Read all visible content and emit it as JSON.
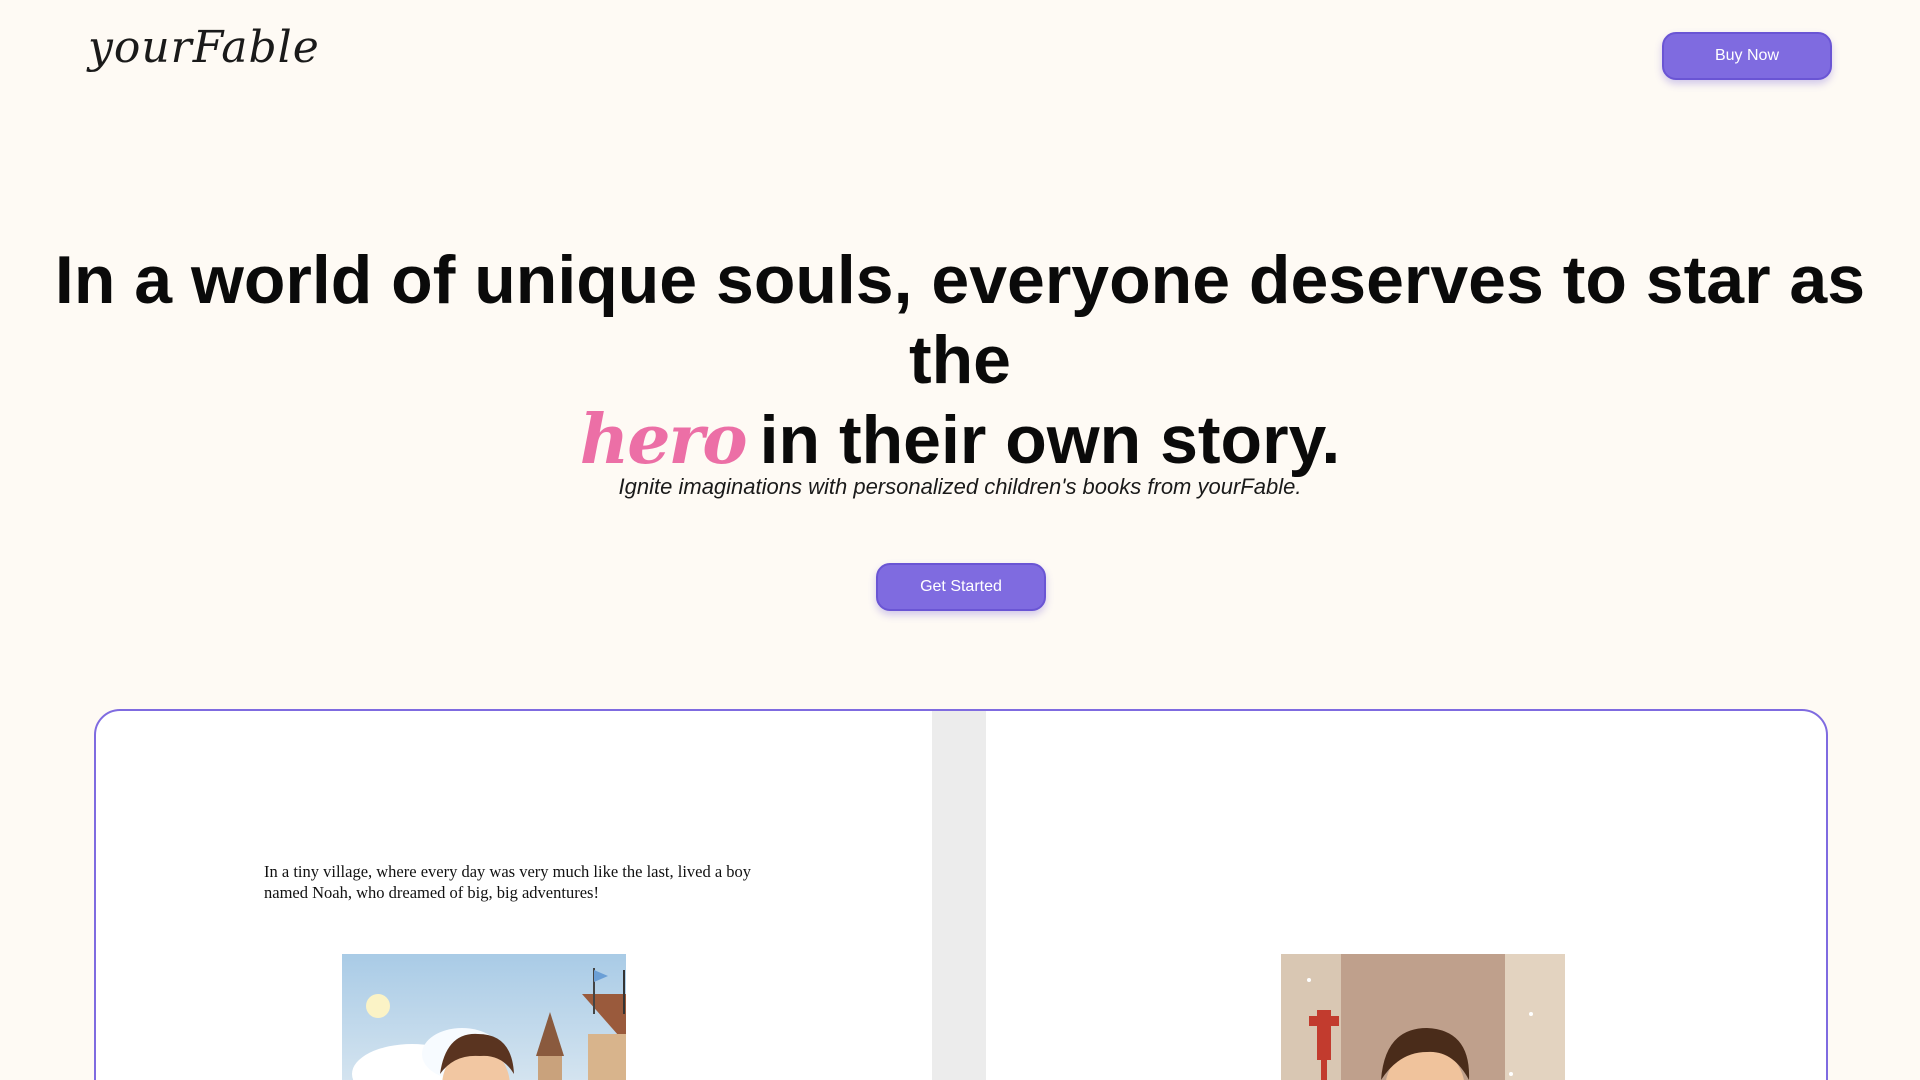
{
  "header": {
    "logo": "yourFable",
    "buy_now_label": "Buy Now"
  },
  "hero": {
    "headline_line1": "In a world of unique souls, everyone deserves to star as the",
    "headline_hero_word": "hero",
    "headline_line2_rest": "in their own story.",
    "tagline": "Ignite imaginations with personalized children's books from yourFable.",
    "get_started_label": "Get Started"
  },
  "book_preview": {
    "left_page_text": "In a tiny village, where every day was very much like the last, lived a boy named Noah, who dreamed of big, big adventures!"
  },
  "colors": {
    "background": "#fefaf4",
    "accent": "#7f6be0",
    "hero_word": "#ec6fa6"
  }
}
